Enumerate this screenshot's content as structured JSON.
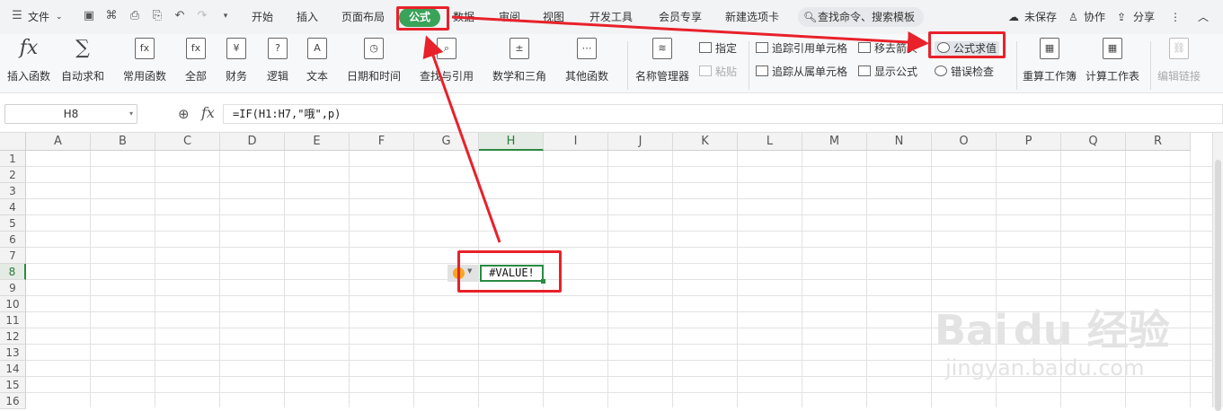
{
  "menu": {
    "file_label": "文件",
    "tabs": [
      "开始",
      "插入",
      "页面布局",
      "公式",
      "数据",
      "审阅",
      "视图",
      "开发工具",
      "会员专享",
      "新建选项卡"
    ],
    "active_tab": "公式",
    "search_text": "查找命令、搜索模板",
    "unsaved_label": "未保存",
    "collab_label": "协作",
    "share_label": "分享"
  },
  "ribbon": {
    "insert_function": "插入函数",
    "autosum": "自动求和",
    "common_functions": "常用函数",
    "all": "全部",
    "finance": "财务",
    "logic": "逻辑",
    "text": "文本",
    "datetime": "日期和时间",
    "lookup": "查找与引用",
    "math": "数学和三角",
    "other_functions": "其他函数",
    "name_manager": "名称管理器",
    "specify": "指定",
    "paste": "粘贴",
    "trace_precedents": "追踪引用单元格",
    "trace_dependents": "追踪从属单元格",
    "remove_arrows": "移去箭头",
    "show_formulas": "显示公式",
    "evaluate_formula": "公式求值",
    "error_check": "错误检查",
    "recalc_workbook": "重算工作簿",
    "calc_sheet": "计算工作表",
    "edit_links": "编辑链接"
  },
  "formula_bar": {
    "name_box": "H8",
    "formula": "=IF(H1:H7,\"哦\",p)"
  },
  "grid": {
    "columns": [
      "A",
      "B",
      "C",
      "D",
      "E",
      "F",
      "G",
      "H",
      "I",
      "J",
      "K",
      "L",
      "M",
      "N",
      "O",
      "P",
      "Q",
      "R"
    ],
    "rows": [
      "1",
      "2",
      "3",
      "4",
      "5",
      "6",
      "7",
      "8",
      "9",
      "10",
      "11",
      "12",
      "13",
      "14",
      "15",
      "16"
    ],
    "selected_column": "H",
    "selected_row": "8",
    "active_cell_value": "#VALUE!"
  },
  "watermark": {
    "brand": "Bai du 经验",
    "url": "jingyan.baidu.com"
  },
  "colors": {
    "accent_green": "#3aa35a",
    "annotation_red": "#e8212a",
    "error_indicator": "#f5a623"
  }
}
